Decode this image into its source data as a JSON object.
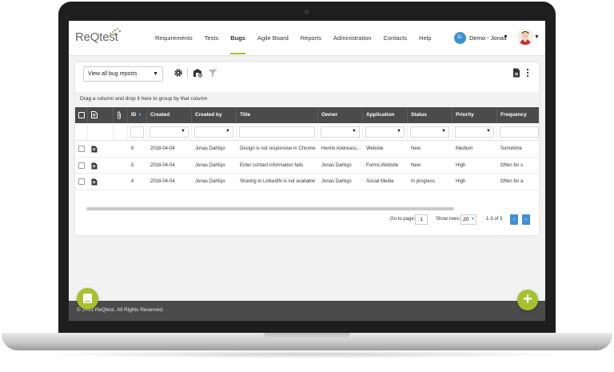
{
  "brand": {
    "logo_text": "ReQtest"
  },
  "nav": {
    "items": [
      {
        "label": "Requirements"
      },
      {
        "label": "Tests"
      },
      {
        "label": "Bugs",
        "active": true
      },
      {
        "label": "Agile Board"
      },
      {
        "label": "Reports"
      },
      {
        "label": "Administration"
      },
      {
        "label": "Contacts"
      },
      {
        "label": "Help"
      }
    ]
  },
  "user": {
    "initials": "D-",
    "name": "Demo - Jonas"
  },
  "toolbar": {
    "view_select": "View all bug reports",
    "icons": [
      "gear-icon",
      "add-report-icon",
      "filter-icon",
      "export-document-icon",
      "more-vertical-icon"
    ]
  },
  "grid": {
    "group_hint": "Drag a column and drop it here to group by that column",
    "columns": [
      "",
      "",
      "",
      "ID",
      "Created",
      "Created by",
      "Title",
      "Owner",
      "Application",
      "Status",
      "Priority",
      "Frequency"
    ],
    "rows": [
      {
        "id": "6",
        "created": "2018-04-04",
        "created_by": "Jonas Dahlsjo",
        "title": "Design is not responsive in Chrome",
        "owner": "Henrik Andreass...",
        "application": "Website",
        "status": "New",
        "priority": "Medium",
        "frequency": "Sometime"
      },
      {
        "id": "5",
        "created": "2018-04-04",
        "created_by": "Jonas Dahlsjo",
        "title": "Enter contact information fails",
        "owner": "Jonas Dahlsjo",
        "application": "Forms,Website",
        "status": "New",
        "priority": "High",
        "frequency": "Often for s"
      },
      {
        "id": "4",
        "created": "2018-04-04",
        "created_by": "Jonas Dahlsjo",
        "title": "Sharing to LinkedIN is not available",
        "owner": "Jonas Dahlsjo",
        "application": "Social Media",
        "status": "In progress",
        "priority": "High",
        "frequency": "Often for a"
      }
    ]
  },
  "pagination": {
    "goto_label": "Go to page:",
    "page": "1",
    "rows_label": "Show rows:",
    "rows": "20",
    "range": "1-3 of 3",
    "prev": "‹",
    "next": "›"
  },
  "footer": {
    "copyright": "© 2018 ReQtest. All Rights Reserved."
  },
  "fab": {
    "add_label": "+"
  },
  "colors": {
    "accent": "#a7c12e",
    "header_bg": "#4b4b4c",
    "primary_blue": "#3f8fd3"
  }
}
